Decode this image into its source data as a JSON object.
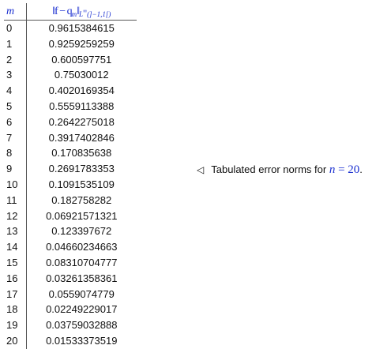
{
  "table": {
    "header": {
      "m": "m",
      "norm_main": "‖f − q",
      "norm_main_sub": "m",
      "norm_close": "‖",
      "norm_space": "L",
      "norm_space_sup": "∞",
      "norm_interval": "(]−1,1[)"
    },
    "rows": [
      {
        "m": "0",
        "value": "0.9615384615"
      },
      {
        "m": "1",
        "value": "0.9259259259"
      },
      {
        "m": "2",
        "value": "0.600597751"
      },
      {
        "m": "3",
        "value": "0.75030012"
      },
      {
        "m": "4",
        "value": "0.4020169354"
      },
      {
        "m": "5",
        "value": "0.5559113388"
      },
      {
        "m": "6",
        "value": "0.2642275018"
      },
      {
        "m": "7",
        "value": "0.3917402846"
      },
      {
        "m": "8",
        "value": "0.170835638"
      },
      {
        "m": "9",
        "value": "0.2691783353"
      },
      {
        "m": "10",
        "value": "0.1091535109"
      },
      {
        "m": "11",
        "value": "0.182758282"
      },
      {
        "m": "12",
        "value": "0.06921571321"
      },
      {
        "m": "13",
        "value": "0.123397672"
      },
      {
        "m": "14",
        "value": "0.04660234663"
      },
      {
        "m": "15",
        "value": "0.08310704777"
      },
      {
        "m": "16",
        "value": "0.03261358361"
      },
      {
        "m": "17",
        "value": "0.0559074779"
      },
      {
        "m": "18",
        "value": "0.02249229017"
      },
      {
        "m": "19",
        "value": "0.03759032888"
      },
      {
        "m": "20",
        "value": "0.01533373519"
      }
    ]
  },
  "caption": {
    "marker": "◁",
    "text": "Tabulated error norms for",
    "math_var": "n",
    "math_rest": " = 20",
    "period": "."
  }
}
